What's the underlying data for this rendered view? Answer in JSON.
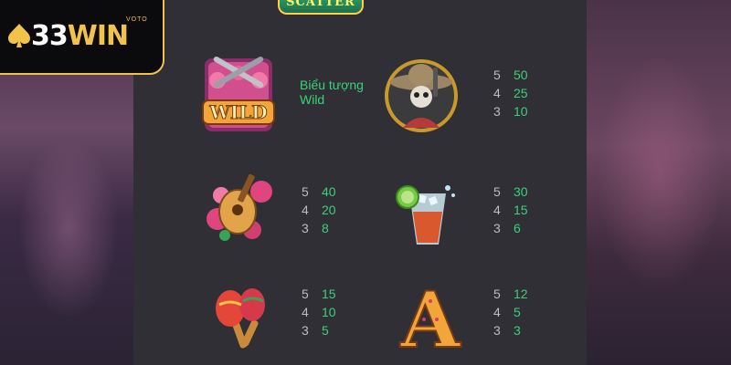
{
  "brand": {
    "logo_number": "33",
    "logo_word": "WIN",
    "logo_sub": "VOTO"
  },
  "banner": {
    "title": "SCATTER"
  },
  "wild": {
    "description": "Biểu tượng Wild"
  },
  "symbols": {
    "mariachi": {
      "name": "mariachi-skeleton",
      "pays": [
        {
          "count": "5",
          "value": "50"
        },
        {
          "count": "4",
          "value": "25"
        },
        {
          "count": "3",
          "value": "10"
        }
      ]
    },
    "guitar": {
      "name": "guitar",
      "pays": [
        {
          "count": "5",
          "value": "40"
        },
        {
          "count": "4",
          "value": "20"
        },
        {
          "count": "3",
          "value": "8"
        }
      ]
    },
    "drink": {
      "name": "cocktail",
      "pays": [
        {
          "count": "5",
          "value": "30"
        },
        {
          "count": "4",
          "value": "15"
        },
        {
          "count": "3",
          "value": "6"
        }
      ]
    },
    "maracas": {
      "name": "maracas",
      "pays": [
        {
          "count": "5",
          "value": "15"
        },
        {
          "count": "4",
          "value": "10"
        },
        {
          "count": "3",
          "value": "5"
        }
      ]
    },
    "letter_a": {
      "name": "letter-a",
      "pays": [
        {
          "count": "5",
          "value": "12"
        },
        {
          "count": "4",
          "value": "5"
        },
        {
          "count": "3",
          "value": "3"
        }
      ]
    }
  },
  "colors": {
    "pay_value": "#39d27a",
    "pay_count": "#bdbdbd",
    "panel": "#2f2f35",
    "brand_gold": "#f2c34a"
  }
}
